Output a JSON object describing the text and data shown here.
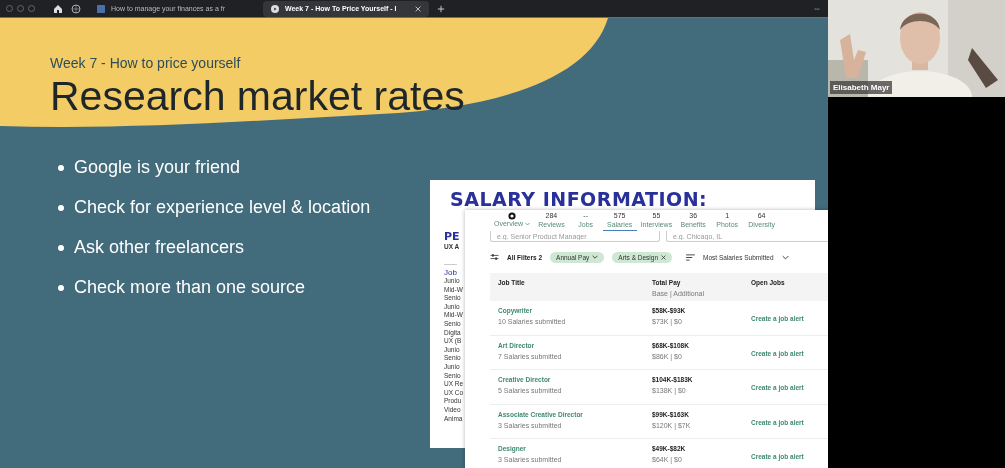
{
  "browser": {
    "tabs": [
      {
        "title": "How to manage your finances as a fr",
        "selected": false
      },
      {
        "title": "Week 7 - How To Price Yourself - I",
        "selected": true
      }
    ]
  },
  "slide": {
    "subtitle": "Week 7 - How to price yourself",
    "title": "Research market rates",
    "bullets": [
      "Google is your friend",
      "Check for experience level & location",
      "Ask other freelancers",
      "Check more than one source"
    ],
    "back_card": {
      "heading": "SALARY INFORMATION:",
      "side_title": "PE",
      "side_subtitle": "UX A",
      "list_heading": "Job",
      "list": [
        "Junio",
        "Mid-W",
        "Senio",
        "Junio",
        "Mid-W",
        "Senio",
        "Digita",
        "UX (B",
        "Junio",
        "Senio",
        "Junio",
        "Senio",
        "UX Re",
        "UX Co",
        "Produ",
        "Video",
        "Anima"
      ]
    },
    "front_card": {
      "stats": [
        {
          "kind": "icon",
          "label": "Overview",
          "selected": false
        },
        {
          "kind": "count",
          "count": "284",
          "label": "Reviews",
          "selected": false
        },
        {
          "kind": "count",
          "count": "--",
          "label": "Jobs",
          "selected": false
        },
        {
          "kind": "count",
          "count": "575",
          "label": "Salaries",
          "selected": true
        },
        {
          "kind": "count",
          "count": "55",
          "label": "Interviews",
          "selected": false
        },
        {
          "kind": "count",
          "count": "36",
          "label": "Benefits",
          "selected": false
        },
        {
          "kind": "count",
          "count": "1",
          "label": "Photos",
          "selected": false
        },
        {
          "kind": "count",
          "count": "64",
          "label": "Diversity",
          "selected": false
        }
      ],
      "search_fields": [
        {
          "placeholder": "e.g. Senior Product Manager"
        },
        {
          "placeholder": "e.g. Chicago, IL"
        }
      ],
      "filters_label": "All Filters 2",
      "chips": [
        {
          "kind": "dropdown",
          "label": "Annual Pay"
        },
        {
          "kind": "removable",
          "label": "Arts & Design"
        }
      ],
      "sort": "Most Salaries Submitted",
      "columns": [
        "Job Title",
        "Total Pay",
        "Open Jobs"
      ],
      "pay_subheading": "Base | Additional",
      "rows": [
        {
          "title": "Copywriter",
          "submitted": "10 Salaries submitted",
          "range": "$58K-$93K",
          "split": "$73K | $0",
          "action": "Create a job alert"
        },
        {
          "title": "Art Director",
          "submitted": "7 Salaries submitted",
          "range": "$68K-$108K",
          "split": "$86K | $0",
          "action": "Create a job alert"
        },
        {
          "title": "Creative Director",
          "submitted": "5 Salaries submitted",
          "range": "$104K-$183K",
          "split": "$138K | $0",
          "action": "Create a job alert"
        },
        {
          "title": "Associate Creative Director",
          "submitted": "3 Salaries submitted",
          "range": "$99K-$163K",
          "split": "$120K | $7K",
          "action": "Create a job alert"
        },
        {
          "title": "Designer",
          "submitted": "3 Salaries submitted",
          "range": "$49K-$82K",
          "split": "$64K | $0",
          "action": "Create a job alert"
        }
      ]
    }
  },
  "webcam": {
    "name": "Elisabeth Mayr"
  }
}
